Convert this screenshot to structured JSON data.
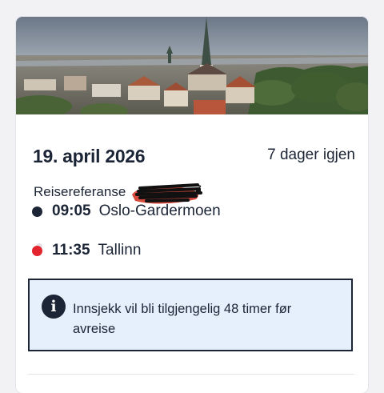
{
  "booking": {
    "date": "19. april 2026",
    "days_left": "7 dager igjen",
    "reference_label": "Reisereferanse"
  },
  "flight": {
    "departure": {
      "time": "09:05",
      "place": "Oslo-Gardermoen"
    },
    "arrival": {
      "time": "11:35",
      "place": "Tallinn"
    }
  },
  "notice": {
    "icon": "info-icon",
    "text": "Innsjekk vil bli tilgjengelig 48 timer før avreise"
  },
  "colors": {
    "navy": "#1c2536",
    "accent_red": "#e3242f",
    "notice_bg": "#e6effc"
  }
}
